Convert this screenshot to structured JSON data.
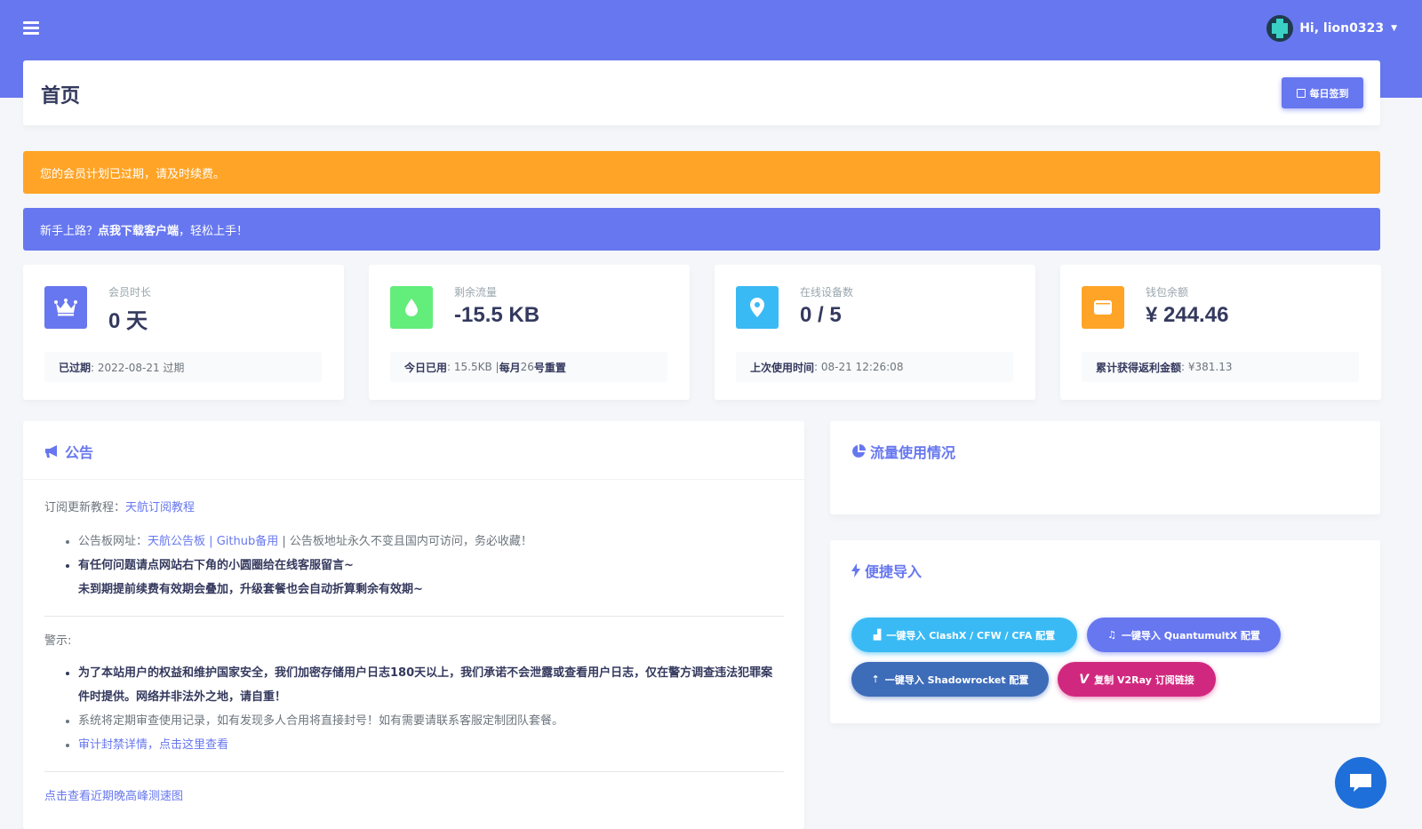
{
  "navbar": {
    "greeting": "Hi, lion0323",
    "accent": "#6777ef"
  },
  "header": {
    "title": "首页",
    "checkin_label": "每日签到"
  },
  "alerts": {
    "expired": "您的会员计划已过期，请及时续费。",
    "newbie_prefix": "新手上路？",
    "newbie_link": "点我下载客户端",
    "newbie_suffix": "，轻松上手！"
  },
  "stats": [
    {
      "icon": "crown-icon",
      "color": "#6777ef",
      "label": "会员时长",
      "value": "0 天",
      "foot_key": "已过期",
      "foot_val": ": 2022-08-21 过期"
    },
    {
      "icon": "drop-icon",
      "color": "#63ed7a",
      "label": "剩余流量",
      "value": "-15.5 KB",
      "foot_key": "今日已用",
      "foot_val": ": 15.5KB | ",
      "foot_key2": "每月",
      "foot_val2": "26",
      "foot_key3": "号重置"
    },
    {
      "icon": "map-pin-icon",
      "color": "#3abaf4",
      "label": "在线设备数",
      "value": "0 / 5",
      "foot_key": "上次使用时间",
      "foot_val": ": 08-21 12:26:08"
    },
    {
      "icon": "wallet-icon",
      "color": "#ffa426",
      "label": "钱包余额",
      "value": "¥ 244.46",
      "foot_key": "累计获得返利金额",
      "foot_val": ": ¥381.13"
    }
  ],
  "notice": {
    "title": "公告",
    "sub_prefix": "订阅更新教程：",
    "sub_link": "天航订阅教程",
    "li1_prefix": "公告板网址：",
    "li1_link1": "天航公告板",
    "li1_sep": " | ",
    "li1_link2": "Github备用",
    "li1_suffix": " | 公告板地址永久不变且国内可访问，务必收藏！",
    "li2_line1": "有任何问题请点网站右下角的小圆圈给在线客服留言~",
    "li2_line2": "未到期提前续费有效期会叠加，升级套餐也会自动折算剩余有效期~",
    "warning_label": "警示:",
    "w1": "为了本站用户的权益和维护国家安全，我们加密存储用户日志180天以上，我们承诺不会泄露或查看用户日志，仅在警方调查违法犯罪案件时提供。网络并非法外之地，请自重！",
    "w2": "系统将定期审查使用记录，如有发现多人合用将直接封号！如有需要请联系客服定制团队套餐。",
    "w3": "审计封禁详情，点击这里查看",
    "bottom_link": "点击查看近期晚高峰测速图"
  },
  "traffic": {
    "title": "流量使用情况"
  },
  "quick_import": {
    "title": "便捷导入",
    "buttons": [
      {
        "label": "一键导入 ClashX / CFW / CFA 配置",
        "color": "#3abaf4"
      },
      {
        "label": "一键导入 QuantumultX 配置",
        "color": "#6777ef"
      },
      {
        "label": "一键导入 Shadowrocket 配置",
        "color": "#3d6cb9"
      },
      {
        "label": "复制 V2Ray 订阅链接",
        "color": "#d1287f"
      }
    ]
  }
}
